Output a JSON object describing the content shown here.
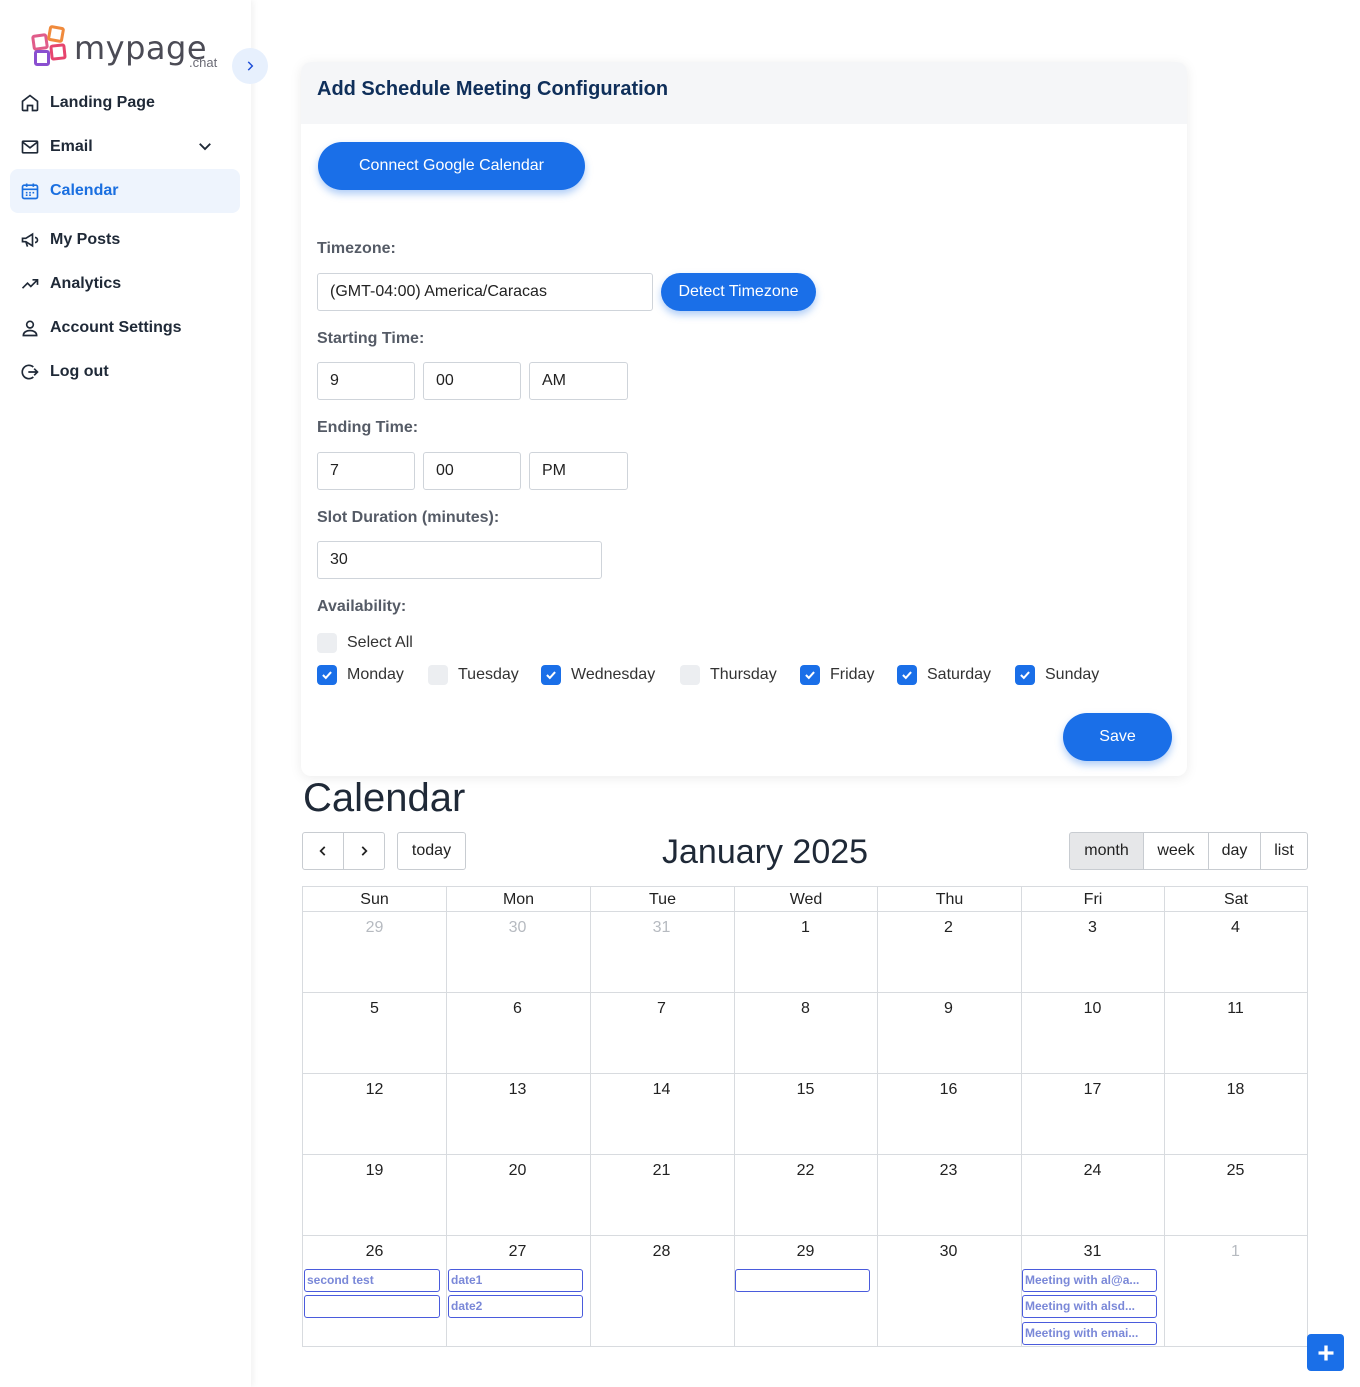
{
  "brand": {
    "name": "mypage",
    "suffix": ".chat"
  },
  "sidebar": {
    "items": [
      {
        "label": "Landing Page",
        "icon": "home-icon"
      },
      {
        "label": "Email",
        "icon": "mail-icon"
      },
      {
        "label": "Calendar",
        "icon": "calendar-icon",
        "active": true
      },
      {
        "label": "My Posts",
        "icon": "megaphone-icon"
      },
      {
        "label": "Analytics",
        "icon": "trend-icon"
      },
      {
        "label": "Account Settings",
        "icon": "user-icon"
      },
      {
        "label": "Log out",
        "icon": "logout-icon"
      }
    ]
  },
  "config": {
    "title": "Add Schedule Meeting Configuration",
    "connect_label": "Connect Google Calendar",
    "timezone_label": "Timezone:",
    "timezone_value": "(GMT-04:00) America/Caracas",
    "detect_label": "Detect Timezone",
    "start_label": "Starting Time:",
    "start": {
      "hour": "9",
      "minute": "00",
      "ampm": "AM"
    },
    "end_label": "Ending Time:",
    "end": {
      "hour": "7",
      "minute": "00",
      "ampm": "PM"
    },
    "slot_label": "Slot Duration (minutes):",
    "slot_value": "30",
    "availability_label": "Availability:",
    "select_all_label": "Select All",
    "days": [
      {
        "label": "Monday",
        "checked": true
      },
      {
        "label": "Tuesday",
        "checked": false
      },
      {
        "label": "Wednesday",
        "checked": true
      },
      {
        "label": "Thursday",
        "checked": false
      },
      {
        "label": "Friday",
        "checked": true
      },
      {
        "label": "Saturday",
        "checked": true
      },
      {
        "label": "Sunday",
        "checked": true
      }
    ],
    "save_label": "Save"
  },
  "calendar": {
    "heading": "Calendar",
    "month_title": "January 2025",
    "today_label": "today",
    "views": [
      "month",
      "week",
      "day",
      "list"
    ],
    "active_view": "month",
    "weekdays": [
      "Sun",
      "Mon",
      "Tue",
      "Wed",
      "Thu",
      "Fri",
      "Sat"
    ],
    "weeks": [
      [
        "29",
        "30",
        "31",
        "1",
        "2",
        "3",
        "4"
      ],
      [
        "5",
        "6",
        "7",
        "8",
        "9",
        "10",
        "11"
      ],
      [
        "12",
        "13",
        "14",
        "15",
        "16",
        "17",
        "18"
      ],
      [
        "19",
        "20",
        "21",
        "22",
        "23",
        "24",
        "25"
      ],
      [
        "26",
        "27",
        "28",
        "29",
        "30",
        "31",
        "1"
      ]
    ],
    "events": [
      {
        "day": "26",
        "title": "second test"
      },
      {
        "day": "26",
        "title": ""
      },
      {
        "day": "27",
        "title": "date1"
      },
      {
        "day": "27",
        "title": "date2"
      },
      {
        "day": "29",
        "title": ""
      },
      {
        "day": "31",
        "title": "Meeting with al@a..."
      },
      {
        "day": "31",
        "title": "Meeting with alsd..."
      },
      {
        "day": "31",
        "title": "Meeting with emai..."
      }
    ]
  },
  "colors": {
    "primary": "#1a6fe8",
    "active_nav_bg": "#eef4fd",
    "event_border": "#4a5bdc"
  }
}
